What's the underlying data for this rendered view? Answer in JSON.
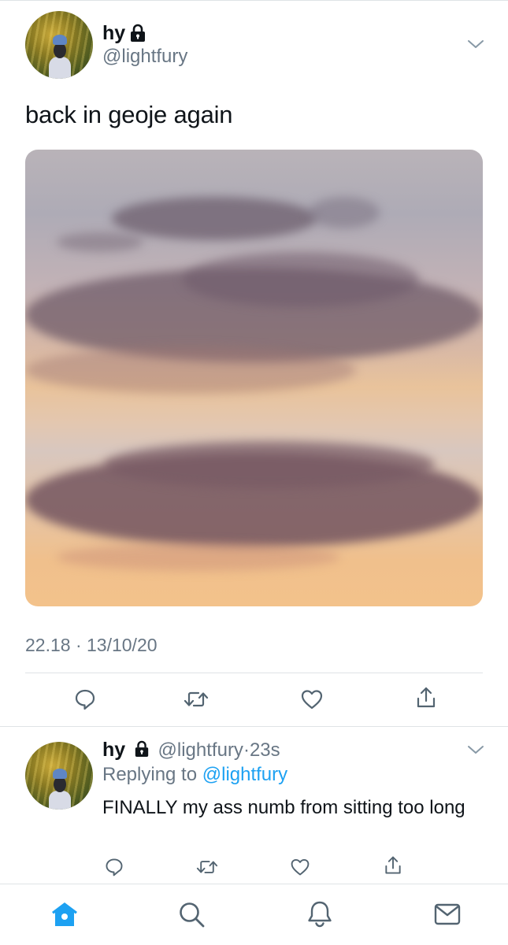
{
  "main_tweet": {
    "display_name": "hy",
    "handle": "@lightfury",
    "text": "back in geoje again",
    "timestamp": "22.18 · 13/10/20",
    "icons": {
      "lock": "lock-icon",
      "menu": "chevron-down-icon"
    }
  },
  "actions": {
    "reply": "comment-icon",
    "retweet": "retweet-icon",
    "like": "heart-icon",
    "share": "share-icon"
  },
  "reply_tweet": {
    "display_name": "hy",
    "handle": "@lightfury",
    "time_separator": "·",
    "time": "23s",
    "replying_to_label": "Replying to",
    "replying_to_handle": "@lightfury",
    "text": "FINALLY my ass numb from sitting too long"
  },
  "tab_bar": {
    "items": [
      {
        "icon": "home-icon",
        "active": true
      },
      {
        "icon": "search-icon",
        "active": false
      },
      {
        "icon": "bell-icon",
        "active": false
      },
      {
        "icon": "mail-icon",
        "active": false
      }
    ]
  },
  "colors": {
    "accent": "#1da1f2",
    "text": "#0f1419",
    "secondary": "#687684",
    "divider": "#dfe3e6"
  }
}
